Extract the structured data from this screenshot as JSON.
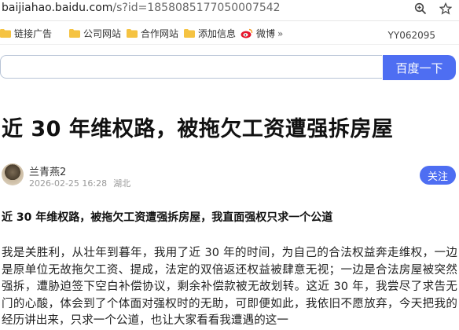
{
  "browser": {
    "url_host": "baijiahao.baidu.com",
    "url_path": "/s?id=1858085177050007542"
  },
  "bookmarks": {
    "items": [
      {
        "label": "链接广告"
      },
      {
        "label": "公司网站"
      },
      {
        "label": "合作网站"
      },
      {
        "label": "添加信息"
      },
      {
        "label": "微博"
      }
    ],
    "right_label": "YY062095"
  },
  "search": {
    "value": "",
    "button_label": "百度一下"
  },
  "article": {
    "title": "近 30 年维权路，被拖欠工资遭强拆房屋",
    "author": "兰青燕2",
    "date": "2026-02-25 16:28",
    "location": "湖北",
    "follow_label": "关注",
    "subhead": "近 30 年维权路，被拖欠工资遭强拆房屋，我直面强权只求一个公道",
    "body": "我是关胜利，从壮年到暮年，我用了近 30 年的时间，为自己的合法权益奔走维权，一边是原单位无故拖欠工资、提成，法定的双倍返还权益被肆意无视；一边是合法房屋被突然强拆，遭胁迫签下空白补偿协议，剩余补偿款被无故划转。这近 30 年，我尝尽了求告无门的心酸，体会到了个体面对强权时的无助，可即便如此，我依旧不愿放弃，今天把我的经历讲出来，只求一个公道，也让大家看看我遭遇的这一"
  },
  "colors": {
    "accent": "#4e6ef2",
    "folder": "#f5c342",
    "weibo": "#e6162d"
  }
}
